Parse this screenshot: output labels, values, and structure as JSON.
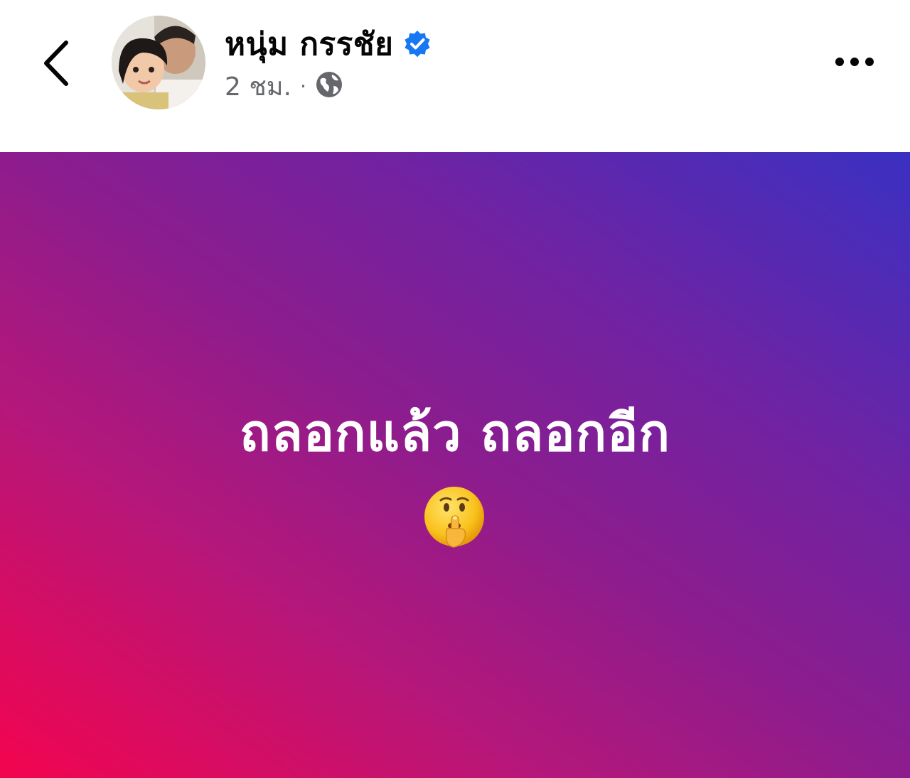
{
  "header": {
    "author_name": "หนุ่ม กรรชัย",
    "time_label": "2 ชม.",
    "separator": "·",
    "verified_icon": "verified-badge-icon",
    "audience_icon": "globe-icon",
    "accent_color": "#1877f2"
  },
  "post": {
    "text": "ถลอกแล้ว ถลอกอีก",
    "emoji": "shushing-face-emoji",
    "background_gradient": [
      "#f3044f",
      "#8a1d8f",
      "#3a30c2"
    ]
  }
}
